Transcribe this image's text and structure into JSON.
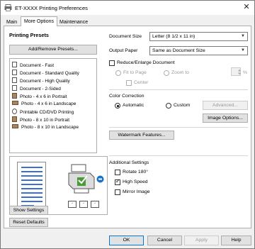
{
  "window": {
    "title": "ET-XXXX Printing Preferences",
    "close": "✕"
  },
  "tabs": [
    "Main",
    "More Options",
    "Maintenance"
  ],
  "presets": {
    "title": "Printing Presets",
    "add_remove": "Add/Remove Presets...",
    "items": [
      "Document - Fast",
      "Document - Standard Quality",
      "Document - High Quality",
      "Document - 2-Sided",
      "Photo - 4 x 6 in Portrait",
      "Photo - 4 x 6 in Landscape",
      "Printable CD/DVD Printing",
      "Photo - 8 x 10 in Portrait",
      "Photo - 8 x 10 in Landscape"
    ]
  },
  "left_buttons": {
    "show_settings": "Show Settings",
    "reset_defaults": "Reset Defaults"
  },
  "document_size": {
    "label": "Document Size",
    "value": "Letter (8 1/2 x 11 in)"
  },
  "output_paper": {
    "label": "Output Paper",
    "value": "Same as Document Size"
  },
  "reduce_enlarge": {
    "label": "Reduce/Enlarge Document",
    "fit_to_page": "Fit to Page",
    "zoom_to": "Zoom to",
    "percent": "%",
    "center": "Center"
  },
  "color_correction": {
    "title": "Color Correction",
    "automatic": "Automatic",
    "custom": "Custom",
    "advanced": "Advanced...",
    "image_options": "Image Options..."
  },
  "watermark": "Watermark Features...",
  "additional": {
    "title": "Additional Settings",
    "rotate": "Rotate 180°",
    "high_speed": "High Speed",
    "mirror": "Mirror Image"
  },
  "bottom": {
    "ok": "OK",
    "cancel": "Cancel",
    "apply": "Apply",
    "help": "Help"
  },
  "colors": {
    "accent": "#0078d7",
    "preview_line": "#3b6fd1"
  }
}
